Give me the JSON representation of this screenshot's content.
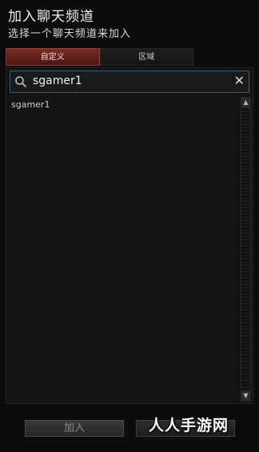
{
  "header": {
    "title": "加入聊天频道",
    "subtitle": "选择一个聊天频道来加入"
  },
  "tabs": [
    {
      "label": "自定义",
      "active": true
    },
    {
      "label": "区域",
      "active": false
    }
  ],
  "search": {
    "value": "sgamer1",
    "icon": "search-icon",
    "clear_glyph": "✕"
  },
  "results": [
    {
      "label": "sgamer1"
    }
  ],
  "scrollbar": {
    "up": "▲",
    "down": "▼"
  },
  "footer": {
    "join_label": "加入"
  },
  "watermark": "人人手游网",
  "colors": {
    "accent_tab": "#7a2a23",
    "search_border": "#2f5f86",
    "background": "#0c0c0c"
  }
}
